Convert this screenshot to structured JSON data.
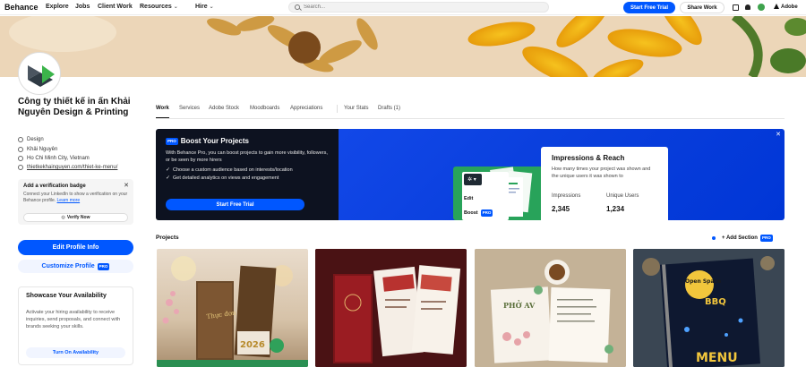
{
  "nav": {
    "logo": "Behance",
    "links": [
      "Explore",
      "Jobs",
      "Client Work",
      "Resources",
      "Hire"
    ],
    "search_placeholder": "Search...",
    "trial_button": "Start Free Trial",
    "share_button": "Share Work",
    "adobe": "Adobe"
  },
  "profile": {
    "name": "Công ty thiết kế in ấn Khải Nguyên Design & Printing",
    "field": "Design",
    "owner": "Khải Nguyên",
    "location": "Ho Chi Minh City, Vietnam",
    "website": "thietkekhainguyen.com/thiet-ke-menu/"
  },
  "verify": {
    "title": "Add a verification badge",
    "text": "Connect your LinkedIn to show a verification on your Behance profile.",
    "learn_more": "Learn more",
    "button": "Verify Now"
  },
  "actions": {
    "edit_profile": "Edit Profile Info",
    "customize_profile": "Customize Profile",
    "pro": "PRO"
  },
  "availability": {
    "title": "Showcase Your Availability",
    "text": "Activate your hiring availability to receive inquiries, send proposals, and connect with brands seeking your skills.",
    "button": "Turn On Availability"
  },
  "tabs": [
    "Work",
    "Services",
    "Adobe Stock",
    "Moodboards",
    "Appreciations",
    "Your Stats",
    "Drafts (1)"
  ],
  "promo": {
    "badge": "PRO",
    "title": "Boost Your Projects",
    "text": "With Behance Pro, you can boost projects to gain more visibility, followers, or be seen by more hirers",
    "check1": "Choose a custom audience based on interests/location",
    "check2": "Get detailed analytics on views and engagement",
    "button": "Start Free Trial",
    "mock_edit": "Edit",
    "mock_boost": "Boost",
    "impressions_title": "Impressions & Reach",
    "impressions_text": "How many times your project was shown and the unique users it was shown to",
    "impressions_label": "Impressions",
    "impressions_value": "2,345",
    "unique_label": "Unique Users",
    "unique_value": "1,234"
  },
  "projects": {
    "label": "Projects",
    "add_section": "Add Section",
    "cards": [
      {
        "alt": "luxury menu covers 2026",
        "year": "2026"
      },
      {
        "alt": "red restaurant menu"
      },
      {
        "alt": "Phở menu book",
        "brand": "PHỞ AV"
      },
      {
        "alt": "Open Space BBQ menu",
        "brand": "Open Space",
        "sub": "BBQ",
        "menu": "MENU"
      }
    ]
  }
}
